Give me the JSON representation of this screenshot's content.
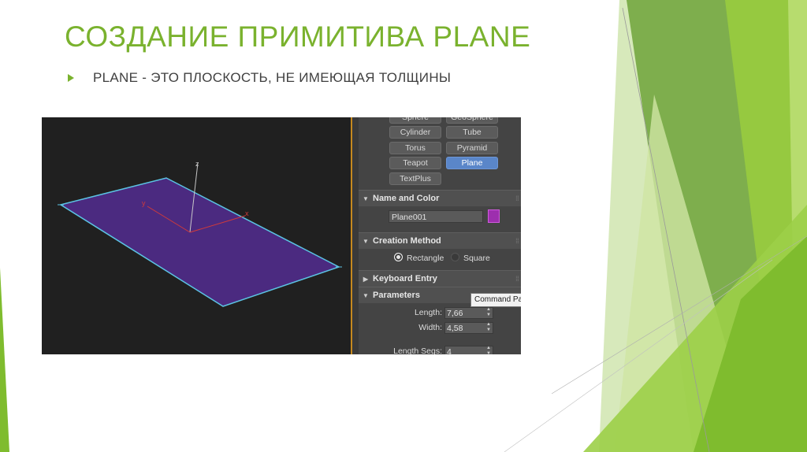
{
  "slide": {
    "title": "СОЗДАНИЕ ПРИМИТИВА PLANE",
    "bullet": "PLANE  - ЭТО ПЛОСКОСТЬ, НЕ ИМЕЮЩАЯ ТОЛЩИНЫ",
    "bullet_icon": "triangle-bullet-icon",
    "accent_color": "#7ab22e"
  },
  "viewport": {
    "axis_labels": {
      "z": "z",
      "y": "y",
      "x": "x"
    },
    "plane_color": "#4b2a80",
    "edge_color": "#5bc3e3"
  },
  "panel": {
    "object_buttons": [
      {
        "label": "Sphere",
        "active": false
      },
      {
        "label": "GeoSphere",
        "active": false
      },
      {
        "label": "Cylinder",
        "active": false
      },
      {
        "label": "Tube",
        "active": false
      },
      {
        "label": "Torus",
        "active": false
      },
      {
        "label": "Pyramid",
        "active": false
      },
      {
        "label": "Teapot",
        "active": false
      },
      {
        "label": "Plane",
        "active": true
      },
      {
        "label": "TextPlus",
        "active": false
      }
    ],
    "name_and_color": {
      "header": "Name and Color",
      "name_value": "Plane001",
      "swatch_color": "#9d2fae"
    },
    "creation_method": {
      "header": "Creation Method",
      "options": [
        "Rectangle",
        "Square"
      ],
      "selected": "Rectangle"
    },
    "keyboard_entry": {
      "header": "Keyboard Entry"
    },
    "parameters": {
      "header": "Parameters",
      "fields": [
        {
          "label": "Length:",
          "value": "7,66"
        },
        {
          "label": "Width:",
          "value": "4,58"
        },
        {
          "label": "Length Segs:",
          "value": "4"
        }
      ]
    },
    "tooltip": "Command Par"
  }
}
